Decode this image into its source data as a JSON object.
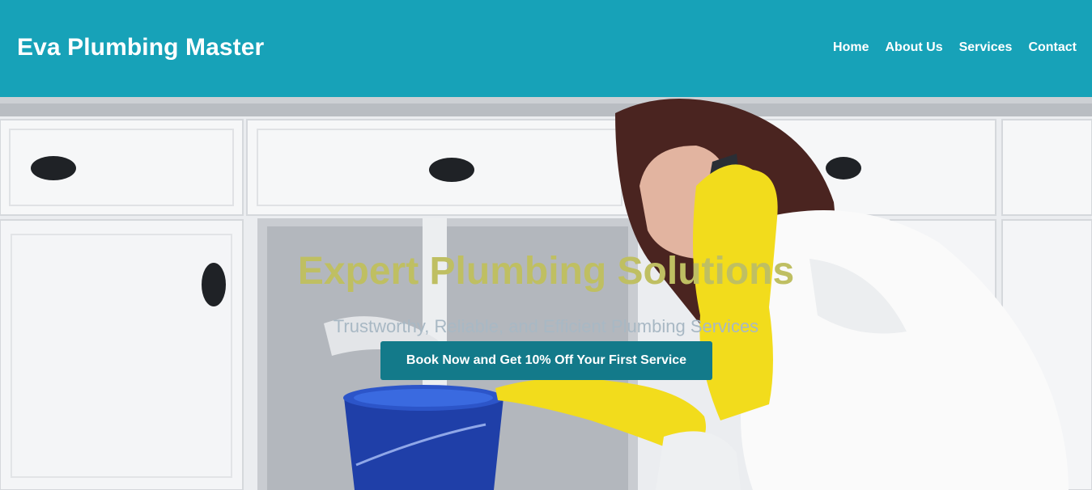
{
  "header": {
    "brand": "Eva Plumbing Master",
    "nav": [
      {
        "label": "Home"
      },
      {
        "label": "About Us"
      },
      {
        "label": "Services"
      },
      {
        "label": "Contact"
      }
    ]
  },
  "hero": {
    "title": "Expert Plumbing Solutions",
    "subtitle": "Trustworthy, Reliable, and Efficient Plumbing Services",
    "cta_label": "Book Now and Get 10% Off Your First Service",
    "background_image": "woman-in-yellow-gloves-on-phone-under-leaking-kitchen-sink"
  },
  "colors": {
    "header_bg": "#17a2b8",
    "title": "#bfbf62",
    "subtitle": "#a8b8c4",
    "cta_bg": "#137a8a",
    "cta_text": "#ffffff"
  }
}
